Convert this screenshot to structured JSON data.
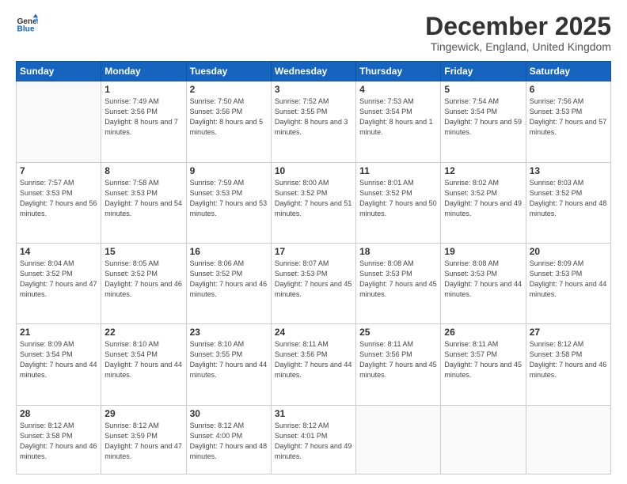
{
  "logo": {
    "line1": "General",
    "line2": "Blue"
  },
  "title": "December 2025",
  "location": "Tingewick, England, United Kingdom",
  "days_of_week": [
    "Sunday",
    "Monday",
    "Tuesday",
    "Wednesday",
    "Thursday",
    "Friday",
    "Saturday"
  ],
  "weeks": [
    [
      {
        "day": "",
        "sunrise": "",
        "sunset": "",
        "daylight": "",
        "empty": true
      },
      {
        "day": "1",
        "sunrise": "Sunrise: 7:49 AM",
        "sunset": "Sunset: 3:56 PM",
        "daylight": "Daylight: 8 hours and 7 minutes.",
        "empty": false
      },
      {
        "day": "2",
        "sunrise": "Sunrise: 7:50 AM",
        "sunset": "Sunset: 3:56 PM",
        "daylight": "Daylight: 8 hours and 5 minutes.",
        "empty": false
      },
      {
        "day": "3",
        "sunrise": "Sunrise: 7:52 AM",
        "sunset": "Sunset: 3:55 PM",
        "daylight": "Daylight: 8 hours and 3 minutes.",
        "empty": false
      },
      {
        "day": "4",
        "sunrise": "Sunrise: 7:53 AM",
        "sunset": "Sunset: 3:54 PM",
        "daylight": "Daylight: 8 hours and 1 minute.",
        "empty": false
      },
      {
        "day": "5",
        "sunrise": "Sunrise: 7:54 AM",
        "sunset": "Sunset: 3:54 PM",
        "daylight": "Daylight: 7 hours and 59 minutes.",
        "empty": false
      },
      {
        "day": "6",
        "sunrise": "Sunrise: 7:56 AM",
        "sunset": "Sunset: 3:53 PM",
        "daylight": "Daylight: 7 hours and 57 minutes.",
        "empty": false
      }
    ],
    [
      {
        "day": "7",
        "sunrise": "Sunrise: 7:57 AM",
        "sunset": "Sunset: 3:53 PM",
        "daylight": "Daylight: 7 hours and 56 minutes.",
        "empty": false
      },
      {
        "day": "8",
        "sunrise": "Sunrise: 7:58 AM",
        "sunset": "Sunset: 3:53 PM",
        "daylight": "Daylight: 7 hours and 54 minutes.",
        "empty": false
      },
      {
        "day": "9",
        "sunrise": "Sunrise: 7:59 AM",
        "sunset": "Sunset: 3:53 PM",
        "daylight": "Daylight: 7 hours and 53 minutes.",
        "empty": false
      },
      {
        "day": "10",
        "sunrise": "Sunrise: 8:00 AM",
        "sunset": "Sunset: 3:52 PM",
        "daylight": "Daylight: 7 hours and 51 minutes.",
        "empty": false
      },
      {
        "day": "11",
        "sunrise": "Sunrise: 8:01 AM",
        "sunset": "Sunset: 3:52 PM",
        "daylight": "Daylight: 7 hours and 50 minutes.",
        "empty": false
      },
      {
        "day": "12",
        "sunrise": "Sunrise: 8:02 AM",
        "sunset": "Sunset: 3:52 PM",
        "daylight": "Daylight: 7 hours and 49 minutes.",
        "empty": false
      },
      {
        "day": "13",
        "sunrise": "Sunrise: 8:03 AM",
        "sunset": "Sunset: 3:52 PM",
        "daylight": "Daylight: 7 hours and 48 minutes.",
        "empty": false
      }
    ],
    [
      {
        "day": "14",
        "sunrise": "Sunrise: 8:04 AM",
        "sunset": "Sunset: 3:52 PM",
        "daylight": "Daylight: 7 hours and 47 minutes.",
        "empty": false
      },
      {
        "day": "15",
        "sunrise": "Sunrise: 8:05 AM",
        "sunset": "Sunset: 3:52 PM",
        "daylight": "Daylight: 7 hours and 46 minutes.",
        "empty": false
      },
      {
        "day": "16",
        "sunrise": "Sunrise: 8:06 AM",
        "sunset": "Sunset: 3:52 PM",
        "daylight": "Daylight: 7 hours and 46 minutes.",
        "empty": false
      },
      {
        "day": "17",
        "sunrise": "Sunrise: 8:07 AM",
        "sunset": "Sunset: 3:53 PM",
        "daylight": "Daylight: 7 hours and 45 minutes.",
        "empty": false
      },
      {
        "day": "18",
        "sunrise": "Sunrise: 8:08 AM",
        "sunset": "Sunset: 3:53 PM",
        "daylight": "Daylight: 7 hours and 45 minutes.",
        "empty": false
      },
      {
        "day": "19",
        "sunrise": "Sunrise: 8:08 AM",
        "sunset": "Sunset: 3:53 PM",
        "daylight": "Daylight: 7 hours and 44 minutes.",
        "empty": false
      },
      {
        "day": "20",
        "sunrise": "Sunrise: 8:09 AM",
        "sunset": "Sunset: 3:53 PM",
        "daylight": "Daylight: 7 hours and 44 minutes.",
        "empty": false
      }
    ],
    [
      {
        "day": "21",
        "sunrise": "Sunrise: 8:09 AM",
        "sunset": "Sunset: 3:54 PM",
        "daylight": "Daylight: 7 hours and 44 minutes.",
        "empty": false
      },
      {
        "day": "22",
        "sunrise": "Sunrise: 8:10 AM",
        "sunset": "Sunset: 3:54 PM",
        "daylight": "Daylight: 7 hours and 44 minutes.",
        "empty": false
      },
      {
        "day": "23",
        "sunrise": "Sunrise: 8:10 AM",
        "sunset": "Sunset: 3:55 PM",
        "daylight": "Daylight: 7 hours and 44 minutes.",
        "empty": false
      },
      {
        "day": "24",
        "sunrise": "Sunrise: 8:11 AM",
        "sunset": "Sunset: 3:56 PM",
        "daylight": "Daylight: 7 hours and 44 minutes.",
        "empty": false
      },
      {
        "day": "25",
        "sunrise": "Sunrise: 8:11 AM",
        "sunset": "Sunset: 3:56 PM",
        "daylight": "Daylight: 7 hours and 45 minutes.",
        "empty": false
      },
      {
        "day": "26",
        "sunrise": "Sunrise: 8:11 AM",
        "sunset": "Sunset: 3:57 PM",
        "daylight": "Daylight: 7 hours and 45 minutes.",
        "empty": false
      },
      {
        "day": "27",
        "sunrise": "Sunrise: 8:12 AM",
        "sunset": "Sunset: 3:58 PM",
        "daylight": "Daylight: 7 hours and 46 minutes.",
        "empty": false
      }
    ],
    [
      {
        "day": "28",
        "sunrise": "Sunrise: 8:12 AM",
        "sunset": "Sunset: 3:58 PM",
        "daylight": "Daylight: 7 hours and 46 minutes.",
        "empty": false
      },
      {
        "day": "29",
        "sunrise": "Sunrise: 8:12 AM",
        "sunset": "Sunset: 3:59 PM",
        "daylight": "Daylight: 7 hours and 47 minutes.",
        "empty": false
      },
      {
        "day": "30",
        "sunrise": "Sunrise: 8:12 AM",
        "sunset": "Sunset: 4:00 PM",
        "daylight": "Daylight: 7 hours and 48 minutes.",
        "empty": false
      },
      {
        "day": "31",
        "sunrise": "Sunrise: 8:12 AM",
        "sunset": "Sunset: 4:01 PM",
        "daylight": "Daylight: 7 hours and 49 minutes.",
        "empty": false
      },
      {
        "day": "",
        "sunrise": "",
        "sunset": "",
        "daylight": "",
        "empty": true
      },
      {
        "day": "",
        "sunrise": "",
        "sunset": "",
        "daylight": "",
        "empty": true
      },
      {
        "day": "",
        "sunrise": "",
        "sunset": "",
        "daylight": "",
        "empty": true
      }
    ]
  ]
}
